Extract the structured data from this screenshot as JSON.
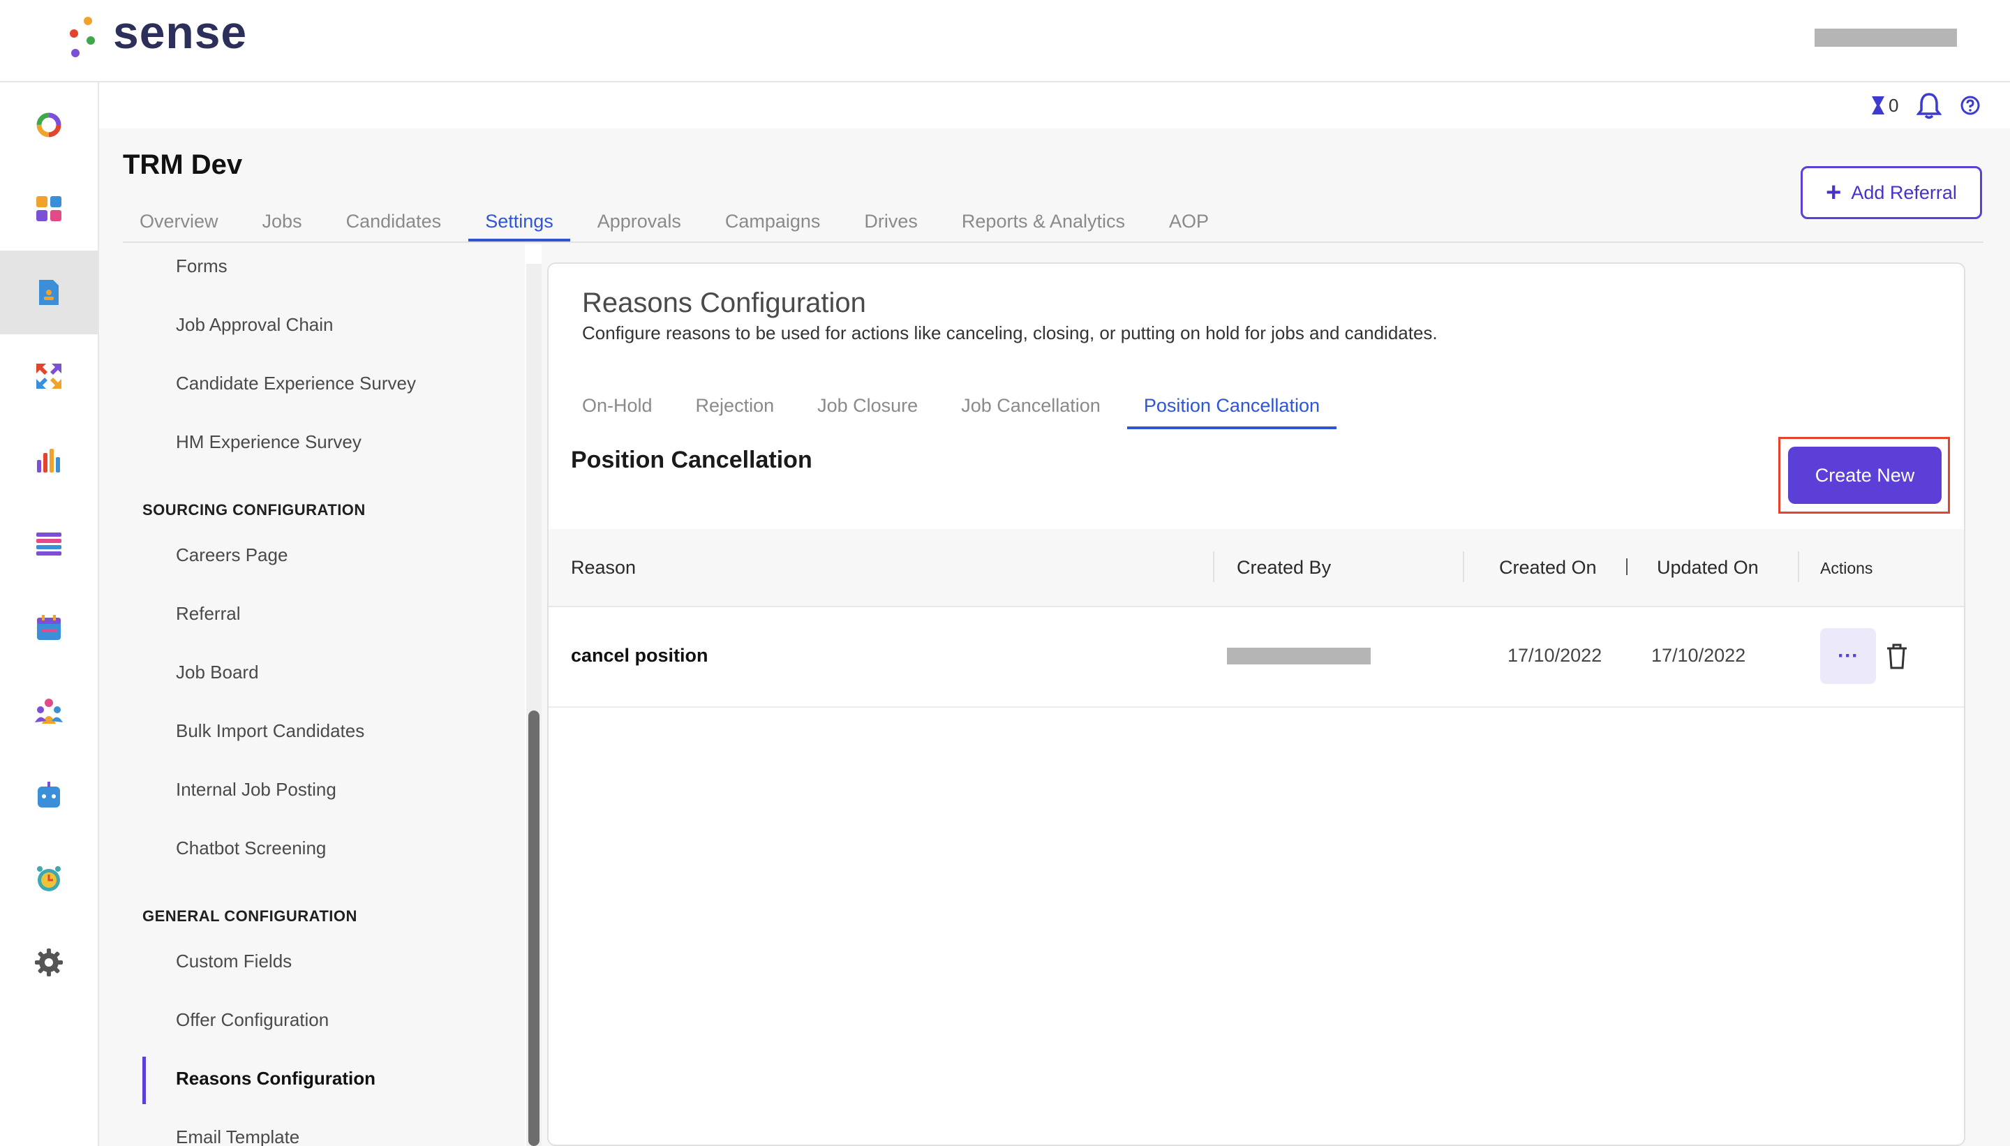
{
  "app": {
    "logo_text": "sense"
  },
  "utility": {
    "hourglass_count": "0"
  },
  "header": {
    "title": "TRM Dev",
    "add_referral_label": "Add Referral",
    "tabs": [
      {
        "label": "Overview"
      },
      {
        "label": "Jobs"
      },
      {
        "label": "Candidates"
      },
      {
        "label": "Settings"
      },
      {
        "label": "Approvals"
      },
      {
        "label": "Campaigns"
      },
      {
        "label": "Drives"
      },
      {
        "label": "Reports & Analytics"
      },
      {
        "label": "AOP"
      }
    ],
    "active_tab": "Settings"
  },
  "submenu": {
    "items_top": [
      "Forms",
      "Job Approval Chain",
      "Candidate Experience Survey",
      "HM Experience Survey"
    ],
    "section_sourcing": "SOURCING CONFIGURATION",
    "sourcing_items": [
      "Careers Page",
      "Referral",
      "Job Board",
      "Bulk Import Candidates",
      "Internal Job Posting",
      "Chatbot Screening"
    ],
    "section_general": "GENERAL CONFIGURATION",
    "general_items": [
      "Custom Fields",
      "Offer Configuration",
      "Reasons Configuration",
      "Email Template"
    ],
    "active_item": "Reasons Configuration"
  },
  "content": {
    "title": "Reasons Configuration",
    "description": "Configure reasons to be used for actions like canceling, closing, or putting on hold for jobs and candidates.",
    "sub_tabs": [
      {
        "label": "On-Hold"
      },
      {
        "label": "Rejection"
      },
      {
        "label": "Job Closure"
      },
      {
        "label": "Job Cancellation"
      },
      {
        "label": "Position Cancellation"
      }
    ],
    "active_sub_tab": "Position Cancellation",
    "section_title": "Position Cancellation",
    "create_new_label": "Create New",
    "table": {
      "columns": [
        "Reason",
        "Created By",
        "Created On",
        "Updated On",
        "Actions"
      ],
      "rows": [
        {
          "reason": "cancel position",
          "created_on": "17/10/2022",
          "updated_on": "17/10/2022",
          "more_label": "···"
        }
      ]
    }
  },
  "colors": {
    "accent": "#5b3fd6",
    "tab_active": "#2f55d4",
    "highlight": "#e2452c"
  }
}
